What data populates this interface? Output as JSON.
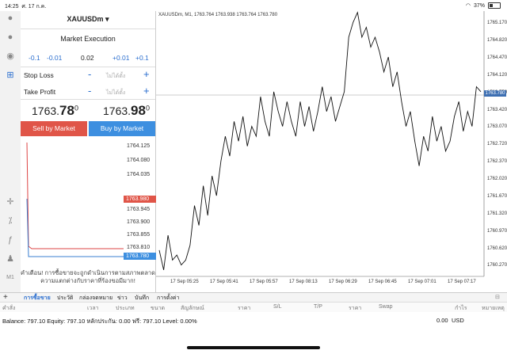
{
  "status": {
    "time": "14:25",
    "date": "ศ. 17 ก.ค.",
    "battery": "37%"
  },
  "panel": {
    "symbol": "XAUUSDm",
    "execution": "Market Execution",
    "lots": [
      "-0.1",
      "-0.01",
      "0.02",
      "+0.01",
      "+0.1"
    ],
    "stop_loss_label": "Stop Loss",
    "take_profit_label": "Take Profit",
    "not_set": "ไม่ได้ตั้ง",
    "minus": "-",
    "plus": "+",
    "bid_main": "1763.",
    "bid_big": "78",
    "bid_sup": "0",
    "ask_main": "1763.",
    "ask_big": "98",
    "ask_sup": "0",
    "sell_label": "Sell by Market",
    "buy_label": "Buy by Market",
    "mini_ticks": [
      "1764.125",
      "1764.080",
      "1764.035",
      "1763.990",
      "1763.945",
      "1763.900",
      "1763.855",
      "1763.810",
      "1763.765"
    ],
    "ask_tag": "1763.980",
    "bid_tag": "1763.780",
    "warning": "คำเตือน! การซื้อขายจะถูกดำเนินการตามสภาพตลาด ความแตกต่างกับราคาที่ร้องขอมีมาก!"
  },
  "chart": {
    "info": "XAUUSDm, M1, 1763.764 1763.938 1763.764 1763.780",
    "current": "1763.780",
    "accent_bid": "#e05548",
    "accent_ask": "#3d8fe0"
  },
  "chart_data": {
    "type": "line",
    "title": "",
    "xlabel": "",
    "ylabel": "",
    "ylim": [
      1760.15,
      1765.3
    ],
    "y_ticks": [
      "1765.170",
      "1764.820",
      "1764.470",
      "1764.120",
      "1763.770",
      "1763.420",
      "1763.070",
      "1762.720",
      "1762.370",
      "1762.020",
      "1761.670",
      "1761.320",
      "1760.970",
      "1760.620",
      "1760.270"
    ],
    "x_ticks": [
      "17 Sep 05:25",
      "17 Sep 05:41",
      "17 Sep 05:57",
      "17 Sep 08:13",
      "17 Sep 06:29",
      "17 Sep 06:45",
      "17 Sep 07:01",
      "17 Sep 07:17"
    ],
    "series": [
      {
        "values": [
          1760.6,
          1760.2,
          1760.9,
          1760.4,
          1760.5,
          1760.3,
          1760.4,
          1760.7,
          1761.5,
          1761.1,
          1761.9,
          1761.3,
          1762.1,
          1761.7,
          1762.4,
          1762.9,
          1762.5,
          1763.2,
          1762.8,
          1763.3,
          1762.7,
          1763.1,
          1762.9,
          1763.7,
          1763.2,
          1762.9,
          1763.8,
          1763.4,
          1763.1,
          1763.6,
          1763.2,
          1762.9,
          1763.6,
          1763.1,
          1763.5,
          1763.0,
          1763.4,
          1763.9,
          1763.4,
          1763.7,
          1763.2,
          1763.5,
          1763.8,
          1764.9,
          1765.2,
          1765.4,
          1764.9,
          1765.1,
          1764.7,
          1764.9,
          1764.6,
          1764.2,
          1764.5,
          1763.9,
          1764.2,
          1763.6,
          1763.1,
          1763.4,
          1762.8,
          1762.3,
          1762.9,
          1762.6,
          1763.3,
          1762.8,
          1763.1,
          1762.6,
          1762.8,
          1763.3,
          1763.6,
          1763.0,
          1763.4,
          1763.1,
          1763.9,
          1763.8
        ]
      }
    ]
  },
  "tabs": [
    "การซื้อขาย",
    "ประวัติ",
    "กล่องจดหมาย",
    "ข่าว",
    "บันทึก",
    "การตั้งค่า"
  ],
  "columns": [
    "คำสั่ง",
    "เวลา",
    "ประเภท",
    "ขนาด",
    "สัญลักษณ์",
    "ราคา",
    "S/L",
    "T/P",
    "ราคา",
    "Swap",
    "กำไร",
    "หมายเหตุ"
  ],
  "balance_text": "Balance: 797.10 Equity: 797.10 หลักประกัน: 0.00 ฟรี: 797.10 Level: 0.00%",
  "total_profit": "0.00",
  "currency": "USD"
}
